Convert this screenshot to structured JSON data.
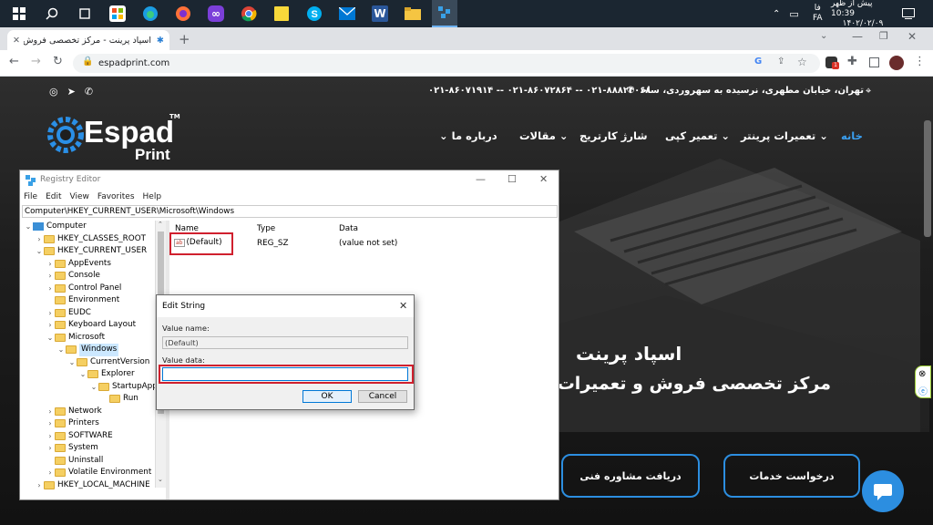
{
  "taskbar": {
    "clock_time": "پیش از ظهر 10:39",
    "clock_date": "۱۴۰۲/۰۲/۰۹",
    "lang": "فا",
    "lang2": "FA"
  },
  "browser": {
    "tab_title": "اسپاد پرینت - مرکز تخصصی فروش",
    "url": "espadprint.com"
  },
  "site": {
    "address": "تهران، خیابان مطهری، نرسیده به سهروردی، ساختمان ۱۲۰",
    "phones": "۰۲۱-۸۸۸۲۴۰۶۸ -- ۰۲۱-۸۶۰۷۲۸۶۴ -- ۰۲۱-۸۶۰۷۱۹۱۴",
    "logo_text": "Espad",
    "logo_sub": "Print",
    "logo_tm": "TM",
    "nav": [
      "خانه",
      "تعمیرات پرینتر",
      "تعمیر کپی",
      "شارژ کارتریج",
      "مقالات",
      "درباره ما"
    ],
    "hero_title": "اسپاد پرینت",
    "hero_subtitle": "مرکز تخصصی فروش و تعمیرات م",
    "cta_services": "درخواست خدمات",
    "cta_consult": "دریافت مشاوره فنی"
  },
  "registry": {
    "title": "Registry Editor",
    "menu": [
      "File",
      "Edit",
      "View",
      "Favorites",
      "Help"
    ],
    "path": "Computer\\HKEY_CURRENT_USER\\Microsoft\\Windows",
    "tree": [
      "Computer",
      "HKEY_CLASSES_ROOT",
      "HKEY_CURRENT_USER",
      "AppEvents",
      "Console",
      "Control Panel",
      "Environment",
      "EUDC",
      "Keyboard Layout",
      "Microsoft",
      "Windows",
      "CurrentVersion",
      "Explorer",
      "StartupApp",
      "Run",
      "Network",
      "Printers",
      "SOFTWARE",
      "System",
      "Uninstall",
      "Volatile Environment",
      "HKEY_LOCAL_MACHINE"
    ],
    "columns": {
      "name": "Name",
      "type": "Type",
      "data": "Data"
    },
    "row": {
      "icon_text": "ab",
      "name": "(Default)",
      "type": "REG_SZ",
      "data": "(value not set)"
    }
  },
  "dialog": {
    "title": "Edit String",
    "value_name_label": "Value name:",
    "value_name": "(Default)",
    "value_data_label": "Value data:",
    "value_data": "",
    "ok": "OK",
    "cancel": "Cancel"
  }
}
